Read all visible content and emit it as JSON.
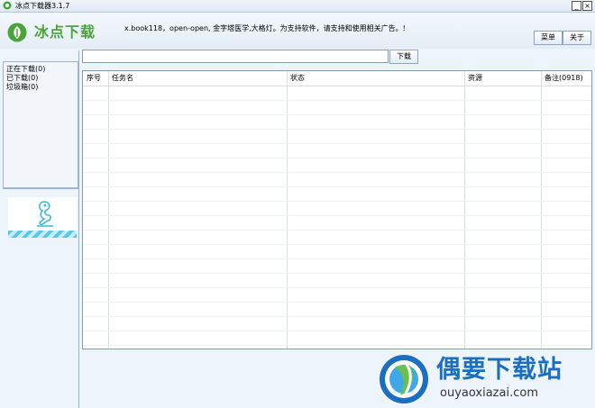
{
  "window": {
    "title": "冰点下载器3.1.7",
    "minimize_glyph": "_",
    "close_glyph": "×"
  },
  "header": {
    "logo_text": "冰点下载",
    "logo_icon": "leaf-logo-icon",
    "marquee": "x.book118，open-open, 金字塔医学,大格灯。为支持软件，请支持和使用相关广告。!",
    "menu_label": "菜单",
    "about_label": "关于"
  },
  "toolbar": {
    "url_value": "",
    "url_placeholder": "",
    "download_label": "下载"
  },
  "sidebar": {
    "items": [
      {
        "label": "正在下载(0)"
      },
      {
        "label": "已下载(0)"
      },
      {
        "label": "垃圾箱(0)"
      }
    ]
  },
  "table": {
    "columns": [
      "序号",
      "任务名",
      "状态",
      "资源",
      "备注(0918)"
    ],
    "rows": []
  },
  "watermark": {
    "name": "偶要下载站",
    "url": "ouyaoxiazai.com"
  },
  "colors": {
    "accent_green": "#4aa43a",
    "brand_blue": "#1a6fc1",
    "border": "#9db2cc"
  }
}
